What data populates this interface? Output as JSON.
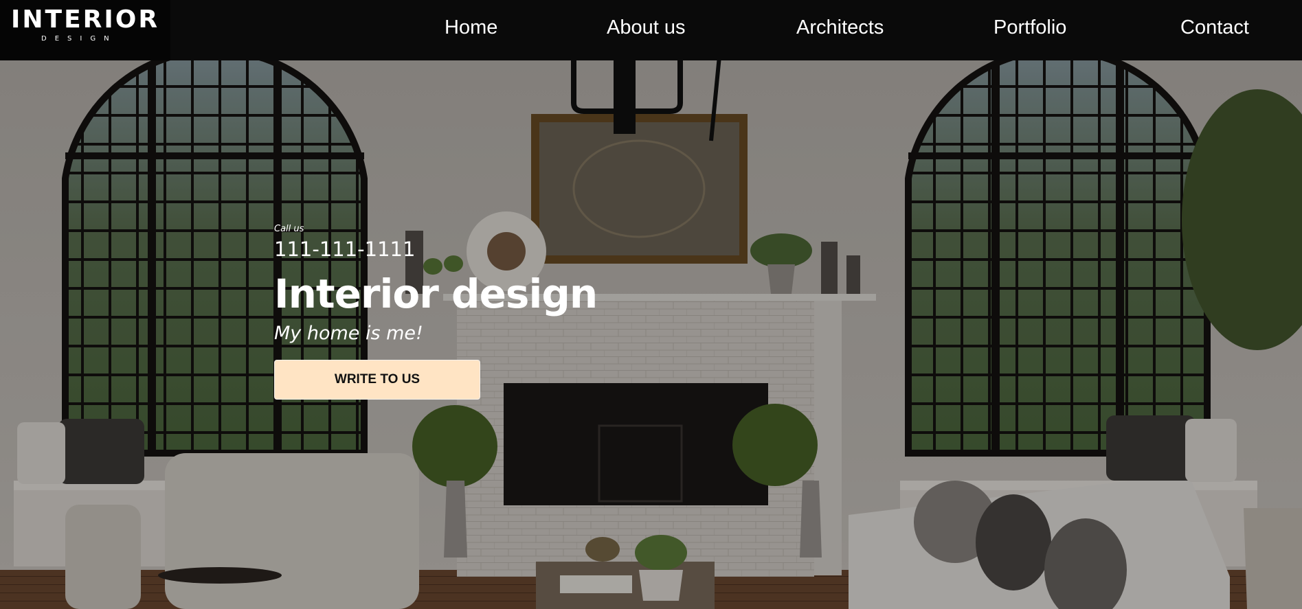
{
  "logo": {
    "main": "INTERIOR",
    "sub": "DESIGN"
  },
  "nav": {
    "items": [
      {
        "label": "Home"
      },
      {
        "label": "About us"
      },
      {
        "label": "Architects"
      },
      {
        "label": "Portfolio"
      },
      {
        "label": "Contact"
      }
    ]
  },
  "hero": {
    "call_label": "Call us",
    "phone": "111-111-1111",
    "title": "Interior design",
    "tagline": "My home is me!",
    "cta_label": "WRITE TO US"
  },
  "colors": {
    "navbar": "#0a0a0a",
    "cta_background": "#ffe4c4",
    "text": "#ffffff"
  }
}
